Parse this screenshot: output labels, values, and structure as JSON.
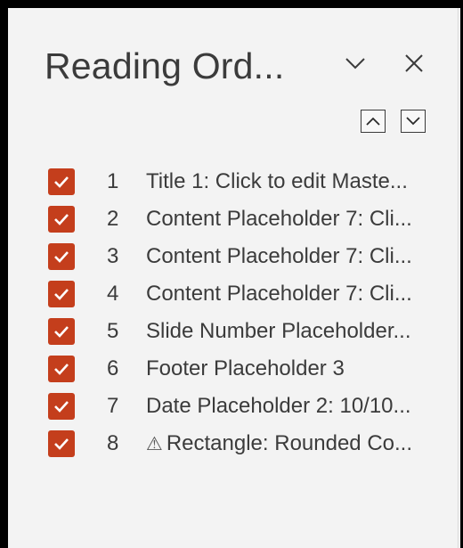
{
  "pane": {
    "title": "Reading Ord...",
    "options_icon": "chevron-down-icon",
    "close_icon": "close-icon"
  },
  "move_controls": {
    "up_icon": "chevron-up-icon",
    "down_icon": "chevron-down-icon"
  },
  "items": [
    {
      "checked": true,
      "number": "1",
      "label": "Title 1: Click to edit Maste...",
      "warning": false
    },
    {
      "checked": true,
      "number": "2",
      "label": "Content Placeholder 7: Cli...",
      "warning": false
    },
    {
      "checked": true,
      "number": "3",
      "label": "Content Placeholder 7: Cli...",
      "warning": false
    },
    {
      "checked": true,
      "number": "4",
      "label": "Content Placeholder 7: Cli...",
      "warning": false
    },
    {
      "checked": true,
      "number": "5",
      "label": "Slide Number Placeholder...",
      "warning": false
    },
    {
      "checked": true,
      "number": "6",
      "label": "Footer Placeholder 3",
      "warning": false
    },
    {
      "checked": true,
      "number": "7",
      "label": "Date Placeholder 2: 10/10...",
      "warning": false
    },
    {
      "checked": true,
      "number": "8",
      "label": "Rectangle: Rounded Co...",
      "warning": true,
      "warning_glyph": "⚠"
    }
  ],
  "colors": {
    "checkbox_accent": "#c43e1c",
    "pane_background": "#f3f3f3",
    "text": "#3b3b3b"
  }
}
